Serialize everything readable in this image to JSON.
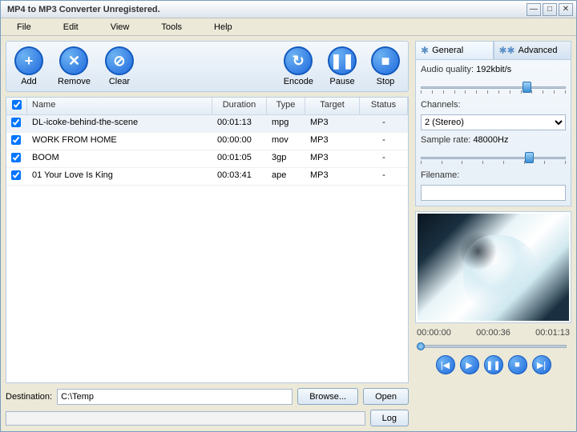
{
  "window": {
    "title": "MP4 to MP3 Converter Unregistered."
  },
  "menu": {
    "file": "File",
    "edit": "Edit",
    "view": "View",
    "tools": "Tools",
    "help": "Help"
  },
  "toolbar": {
    "add": "Add",
    "remove": "Remove",
    "clear": "Clear",
    "encode": "Encode",
    "pause": "Pause",
    "stop": "Stop"
  },
  "columns": {
    "name": "Name",
    "duration": "Duration",
    "type": "Type",
    "target": "Target",
    "status": "Status"
  },
  "rows": [
    {
      "name": "DL-icoke-behind-the-scene",
      "duration": "00:01:13",
      "type": "mpg",
      "target": "MP3",
      "status": "-"
    },
    {
      "name": "WORK FROM HOME",
      "duration": "00:00:00",
      "type": "mov",
      "target": "MP3",
      "status": "-"
    },
    {
      "name": "BOOM",
      "duration": "00:01:05",
      "type": "3gp",
      "target": "MP3",
      "status": "-"
    },
    {
      "name": "01 Your Love Is King",
      "duration": "00:03:41",
      "type": "ape",
      "target": "MP3",
      "status": "-"
    }
  ],
  "dest": {
    "label": "Destination:",
    "value": "C:\\Temp",
    "browse": "Browse...",
    "open": "Open"
  },
  "log": "Log",
  "tabs": {
    "general": "General",
    "advanced": "Advanced"
  },
  "settings": {
    "quality_label": "Audio quality:",
    "quality_value": "192kbit/s",
    "channels_label": "Channels:",
    "channels_value": "2 (Stereo)",
    "sample_label": "Sample rate:",
    "sample_value": "48000Hz",
    "filename_label": "Filename:",
    "filename_value": ""
  },
  "playback": {
    "t0": "00:00:00",
    "t1": "00:00:36",
    "t2": "00:01:13"
  }
}
